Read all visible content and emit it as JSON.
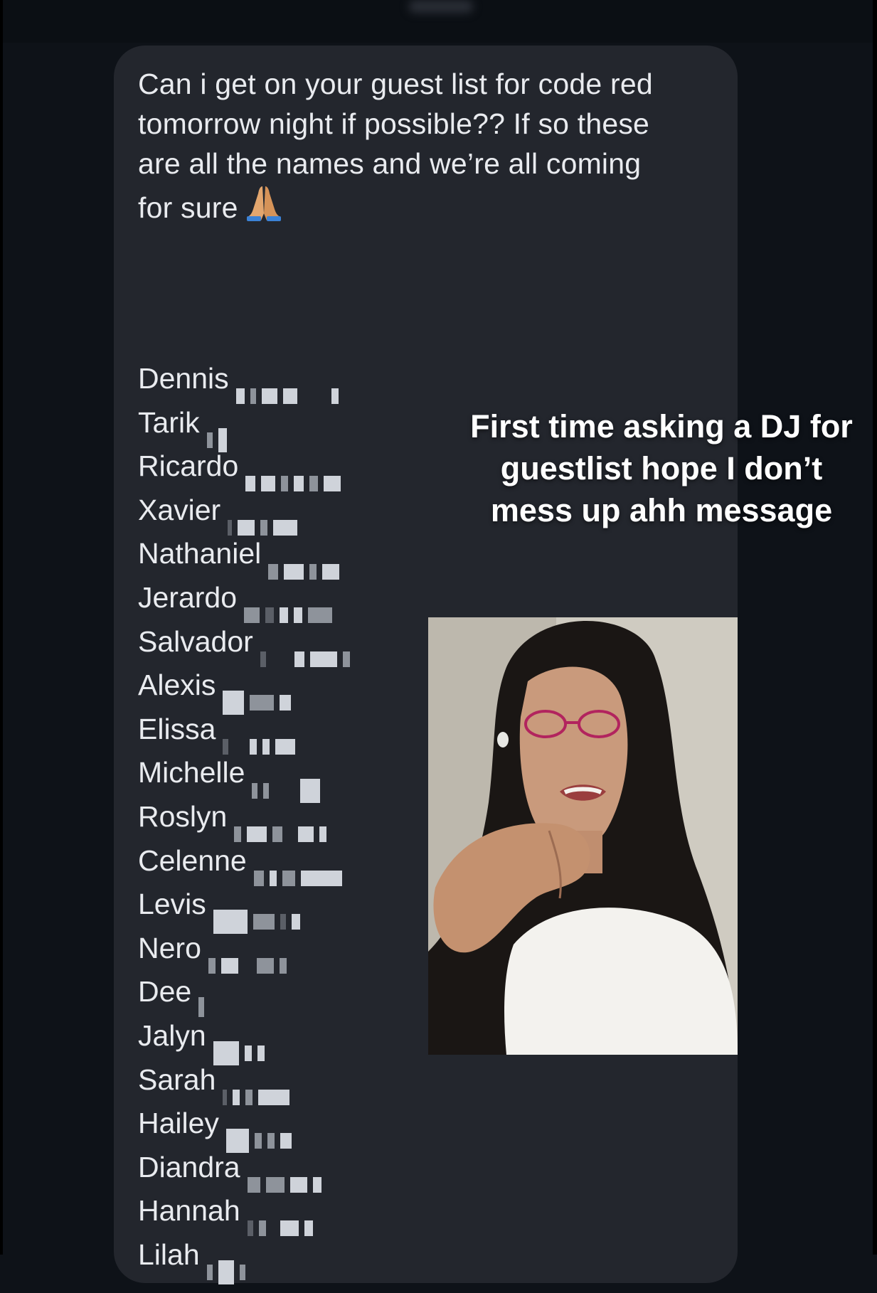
{
  "message": {
    "lines": [
      "Can i get on your guest list for code red",
      "tomorrow night if possible?? If so these",
      "are all the names and we’re all coming",
      "for sure"
    ],
    "emoji": "pray-emoji"
  },
  "guest_names": [
    "Dennis",
    "Tarik",
    "Ricardo",
    "Xavier",
    "Nathaniel",
    "Jerardo",
    "Salvador",
    "Alexis",
    "Elissa",
    "Michelle",
    "Roslyn",
    "Celenne",
    "Levis",
    "Nero",
    "Dee",
    "Jalyn",
    "Sarah",
    "Hailey",
    "Diandra",
    "Hannah",
    "Lilah"
  ],
  "overlay_caption": {
    "lines": [
      "First time asking a DJ for",
      "guestlist hope I don’t",
      "mess up ahh message"
    ]
  },
  "colors": {
    "background": "#0e1218",
    "bubble": "#23262d",
    "text": "#e9ebef",
    "caption": "#ffffff"
  }
}
